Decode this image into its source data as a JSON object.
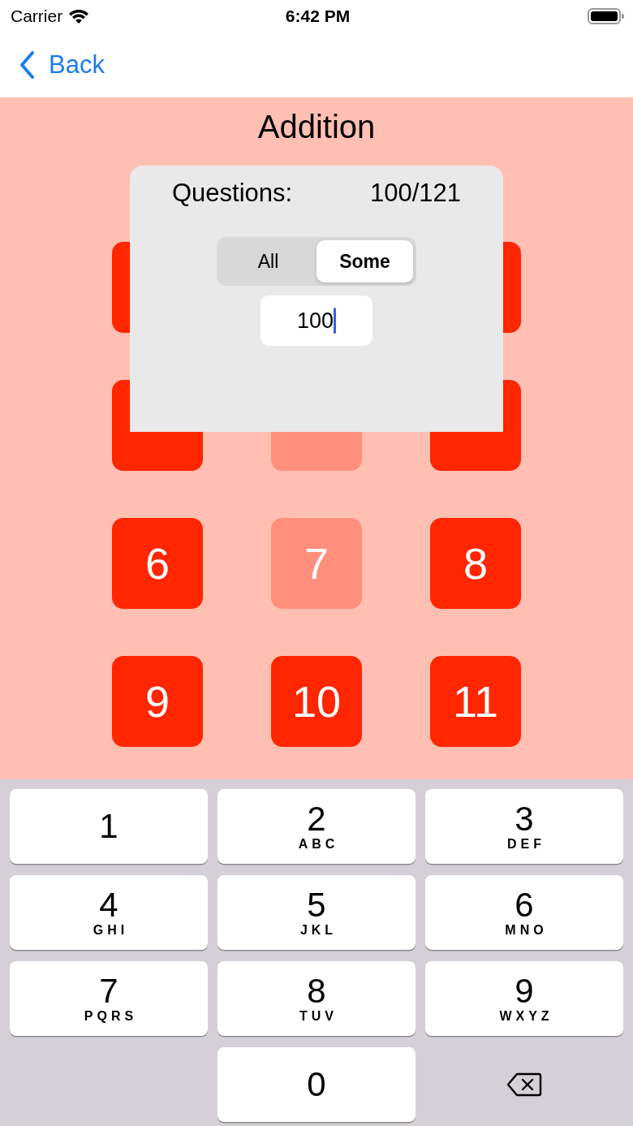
{
  "status_bar": {
    "carrier": "Carrier",
    "time": "6:42 PM"
  },
  "nav": {
    "back": "Back"
  },
  "title": "Addition",
  "tile_rows": [
    [
      {
        "dimmed": false
      },
      {
        "dimmed": false
      }
    ],
    [
      {
        "dimmed": false
      },
      {
        "dimmed": true
      },
      {
        "dimmed": false
      }
    ],
    [
      {
        "label": "6",
        "dimmed": false
      },
      {
        "label": "7",
        "dimmed": true
      },
      {
        "label": "8",
        "dimmed": false
      }
    ],
    [
      {
        "label": "9",
        "dimmed": false
      },
      {
        "label": "10",
        "dimmed": false
      },
      {
        "label": "11",
        "dimmed": false
      }
    ]
  ],
  "popup": {
    "label": "Questions:",
    "count": "100/121",
    "segments": [
      {
        "label": "All",
        "selected": false
      },
      {
        "label": "Some",
        "selected": true
      }
    ],
    "field": {
      "value": "100"
    }
  },
  "keyboard": [
    {
      "kind": "key",
      "digit": "1"
    },
    {
      "kind": "key",
      "digit": "2",
      "letters": "ABC"
    },
    {
      "kind": "key",
      "digit": "3",
      "letters": "DEF"
    },
    {
      "kind": "key",
      "digit": "4",
      "letters": "GHI"
    },
    {
      "kind": "key",
      "digit": "5",
      "letters": "JKL"
    },
    {
      "kind": "key",
      "digit": "6",
      "letters": "MNO"
    },
    {
      "kind": "key",
      "digit": "7",
      "letters": "PQRS"
    },
    {
      "kind": "key",
      "digit": "8",
      "letters": "TUV"
    },
    {
      "kind": "key",
      "digit": "9",
      "letters": "WXYZ"
    },
    {
      "kind": "blank"
    },
    {
      "kind": "key",
      "digit": "0"
    },
    {
      "kind": "backspace"
    }
  ]
}
